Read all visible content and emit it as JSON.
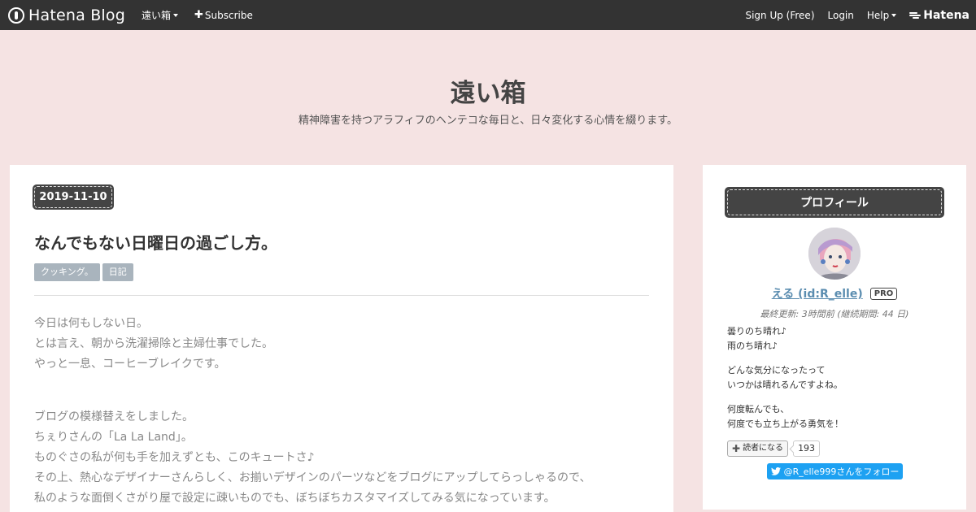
{
  "topbar": {
    "brand": "Hatena Blog",
    "blog_menu": "遠い箱",
    "subscribe": "Subscribe",
    "signup": "Sign Up (Free)",
    "login": "Login",
    "help": "Help",
    "hatena": "Hatena"
  },
  "header": {
    "title": "遠い箱",
    "description": "精神障害を持つアラフィフのヘンテコな毎日と、日々変化する心情を綴ります。"
  },
  "entry": {
    "date": "2019-11-10",
    "title": "なんでもない日曜日の過ごし方。",
    "categories": [
      "クッキング。",
      "日記"
    ],
    "paragraphs": [
      [
        "今日は何もしない日。",
        "とは言え、朝から洗濯掃除と主婦仕事でした。",
        "やっと一息、コーヒーブレイクです。"
      ],
      [
        "ブログの模様替えをしました。",
        "ちぇりさんの「La La Land」。",
        "ものぐさの私が何も手を加えずとも、このキュートさ♪",
        "その上、熱心なデザイナーさんらしく、お揃いデザインのパーツなどをブログにアップしてらっしゃるので、",
        "私のような面倒くさがり屋で設定に疎いものでも、ぼちぼちカスタマイズしてみる気になっています。"
      ]
    ]
  },
  "sidebar": {
    "heading": "プロフィール",
    "name": "える (id:R_elle)",
    "pro": "PRO",
    "last_update": "最終更新: 3時間前 (継続期間: 44 日)",
    "about": [
      [
        "曇りのち晴れ♪",
        "雨のち晴れ♪"
      ],
      [
        "どんな気分になったって",
        "いつかは晴れるんですよね。"
      ],
      [
        "何度転んでも、",
        "何度でも立ち上がる勇気を！"
      ]
    ],
    "subscribe_label": "読者になる",
    "subscriber_count": "193",
    "twitter_follow": "@R_elle999さんをフォロー"
  },
  "colors": {
    "topbar_bg": "#333333",
    "page_bg": "#f5e3e3",
    "badge_bg": "#444444",
    "category_bg": "#a9b4bd",
    "link": "#5b8db0",
    "twitter": "#1da1f2"
  }
}
